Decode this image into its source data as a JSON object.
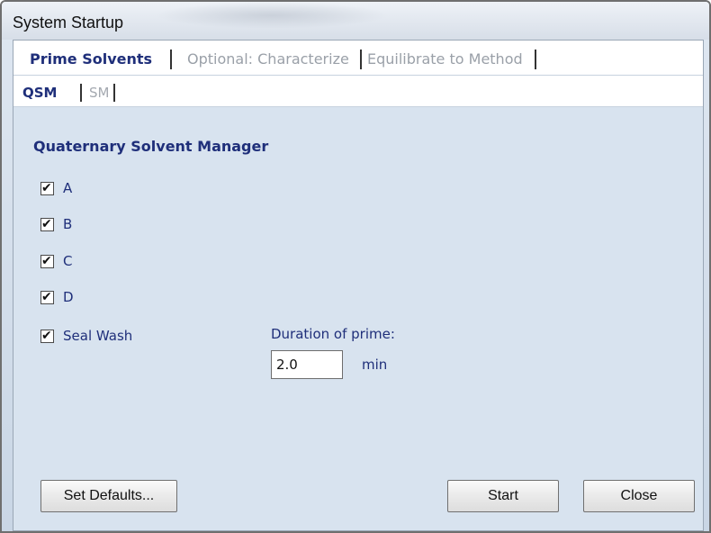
{
  "window": {
    "title": "System Startup"
  },
  "tabs": [
    {
      "label": "Prime Solvents",
      "active": true
    },
    {
      "label": "Optional: Characterize",
      "active": false
    },
    {
      "label": "Equilibrate to Method",
      "active": false
    }
  ],
  "subtabs": [
    {
      "label": "QSM",
      "active": true
    },
    {
      "label": "SM",
      "active": false
    }
  ],
  "section": {
    "title": "Quaternary Solvent Manager"
  },
  "solvents": [
    {
      "label": "A",
      "checked": true
    },
    {
      "label": "B",
      "checked": true
    },
    {
      "label": "C",
      "checked": true
    },
    {
      "label": "D",
      "checked": true
    },
    {
      "label": "Seal Wash",
      "checked": true
    }
  ],
  "duration": {
    "label": "Duration of prime:",
    "value": "2.0",
    "unit": "min"
  },
  "buttons": {
    "defaults": "Set Defaults...",
    "start": "Start",
    "close": "Close"
  },
  "icons": {
    "checkbox_mark": "✔"
  }
}
